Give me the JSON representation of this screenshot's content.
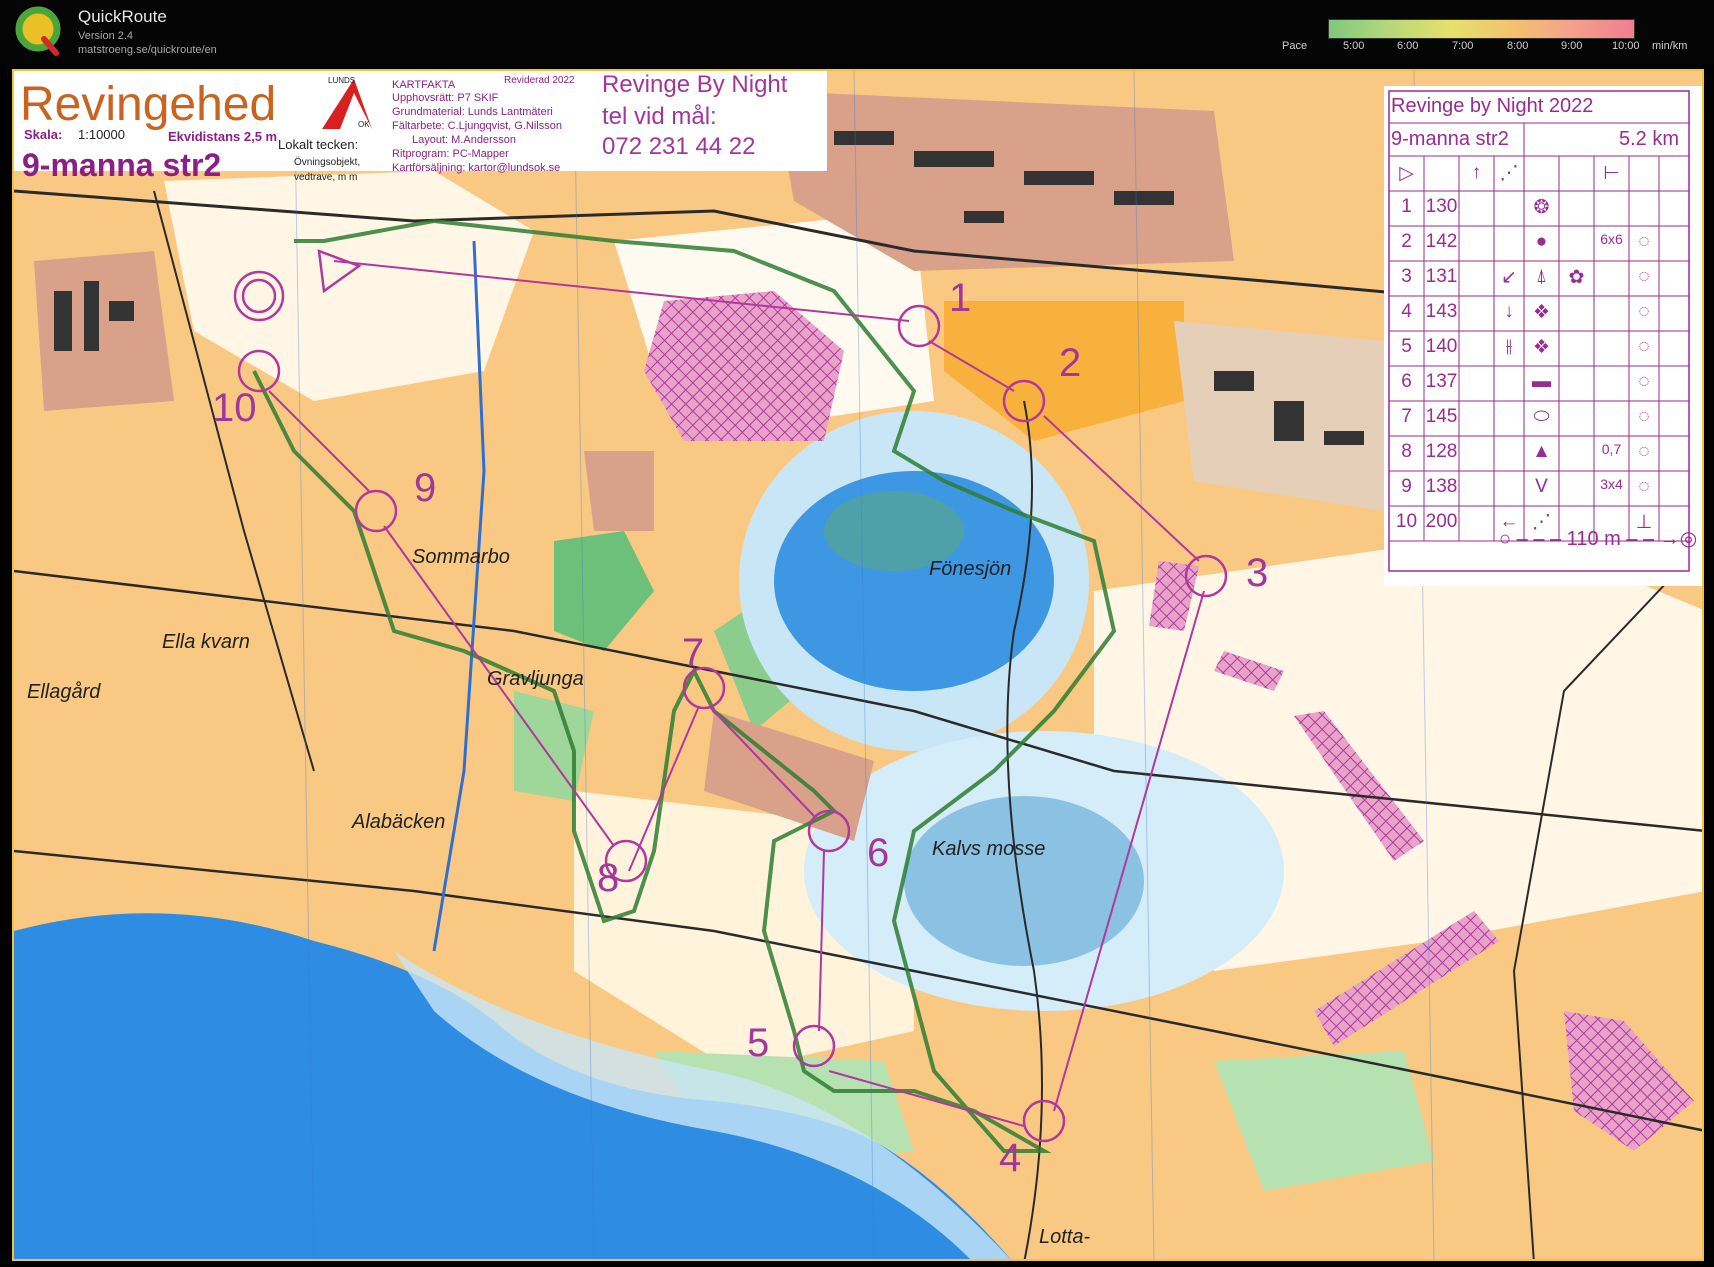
{
  "app": {
    "title": "QuickRoute",
    "version": "Version 2.4",
    "url": "matstroeng.se/quickroute/en",
    "logo_icon": "quickroute-q-logo"
  },
  "pace_legend": {
    "label": "Pace",
    "ticks": [
      "5:00",
      "6:00",
      "7:00",
      "8:00",
      "9:00",
      "10:00"
    ],
    "unit": "min/km",
    "colors": [
      "#7fc97f",
      "#b7d77a",
      "#e6e06c",
      "#f3c26e",
      "#f4a08c",
      "#f07e8e"
    ]
  },
  "map_header": {
    "area_name": "Revingehed",
    "scale_label": "Skala:",
    "scale_value": "1:10000",
    "contour_interval": "Ekvidistans 2,5 m",
    "course": "9-manna str2",
    "local_symbols_title": "Lokalt tecken:",
    "local_symbols": [
      "Övningsobjekt,",
      "vedtrave, m m"
    ],
    "club_logo_text": [
      "LUNDS",
      "OK"
    ],
    "kartfakta_title": "KARTFAKTA",
    "revision": "Reviderad 2022",
    "kartfakta_lines": [
      "Upphovsrätt: P7 SKIF",
      "Grundmaterial: Lunds Lantmäteri",
      "Fältarbete: C.Ljungqvist, G.Nilsson",
      "Layout: M.Andersson",
      "Ritprogram: PC-Mapper",
      "Kartförsäljning: kartor@lundsok.se"
    ],
    "event_lines": [
      "Revinge By Night",
      "tel vid mål:",
      "072 231 44 22"
    ]
  },
  "control_description": {
    "title": "Revinge by Night 2022",
    "course": "9-manna str2",
    "distance": "5.2 km",
    "header_symbols": [
      "▷",
      "",
      "↑",
      "⋰",
      "",
      "",
      "⊢",
      ""
    ],
    "rows": [
      {
        "num": "1",
        "code": "130",
        "col_d": "",
        "col_e": "❂",
        "col_f": "",
        "col_g": "",
        "col_h": ""
      },
      {
        "num": "2",
        "code": "142",
        "col_d": "",
        "col_e": "●",
        "col_f": "",
        "col_g": "6x6",
        "col_h": "◌"
      },
      {
        "num": "3",
        "code": "131",
        "col_d": "↙",
        "col_e": "⍋",
        "col_f": "✿",
        "col_g": "",
        "col_h": "◌"
      },
      {
        "num": "4",
        "code": "143",
        "col_d": "↓",
        "col_e": "❖",
        "col_f": "",
        "col_g": "",
        "col_h": "◌"
      },
      {
        "num": "5",
        "code": "140",
        "col_d": "⫲",
        "col_e": "❖",
        "col_f": "",
        "col_g": "",
        "col_h": "◌"
      },
      {
        "num": "6",
        "code": "137",
        "col_d": "",
        "col_e": "▬",
        "col_f": "",
        "col_g": "",
        "col_h": "◌"
      },
      {
        "num": "7",
        "code": "145",
        "col_d": "",
        "col_e": "⬭",
        "col_f": "",
        "col_g": "",
        "col_h": "◌"
      },
      {
        "num": "8",
        "code": "128",
        "col_d": "",
        "col_e": "▲",
        "col_f": "",
        "col_g": "0,7",
        "col_h": "◌"
      },
      {
        "num": "9",
        "code": "138",
        "col_d": "",
        "col_e": "V",
        "col_f": "",
        "col_g": "3x4",
        "col_h": "◌"
      },
      {
        "num": "10",
        "code": "200",
        "col_d": "←",
        "col_e": "⋰",
        "col_f": "",
        "col_g": "",
        "col_h": "⊥"
      }
    ],
    "finish_line": "○ – – – 110 m – – →◎"
  },
  "controls": [
    {
      "label": "1"
    },
    {
      "label": "2"
    },
    {
      "label": "3"
    },
    {
      "label": "4"
    },
    {
      "label": "5"
    },
    {
      "label": "6"
    },
    {
      "label": "7"
    },
    {
      "label": "8"
    },
    {
      "label": "9"
    },
    {
      "label": "10"
    }
  ],
  "place_names": [
    "Fönesjön",
    "Kalvs mosse",
    "Sommarbo",
    "Ella kvarn",
    "Ellagård",
    "Gravljunga",
    "Alabäcken",
    "Lotta-"
  ],
  "colors": {
    "course_magenta": "#b0389e",
    "route_green": "#2f7d32",
    "water_blue": "#3b8fe0",
    "open_land": "#f9c984",
    "forest_green": "#6cc07a",
    "building": "#333333",
    "settlement": "#d9a08a"
  }
}
